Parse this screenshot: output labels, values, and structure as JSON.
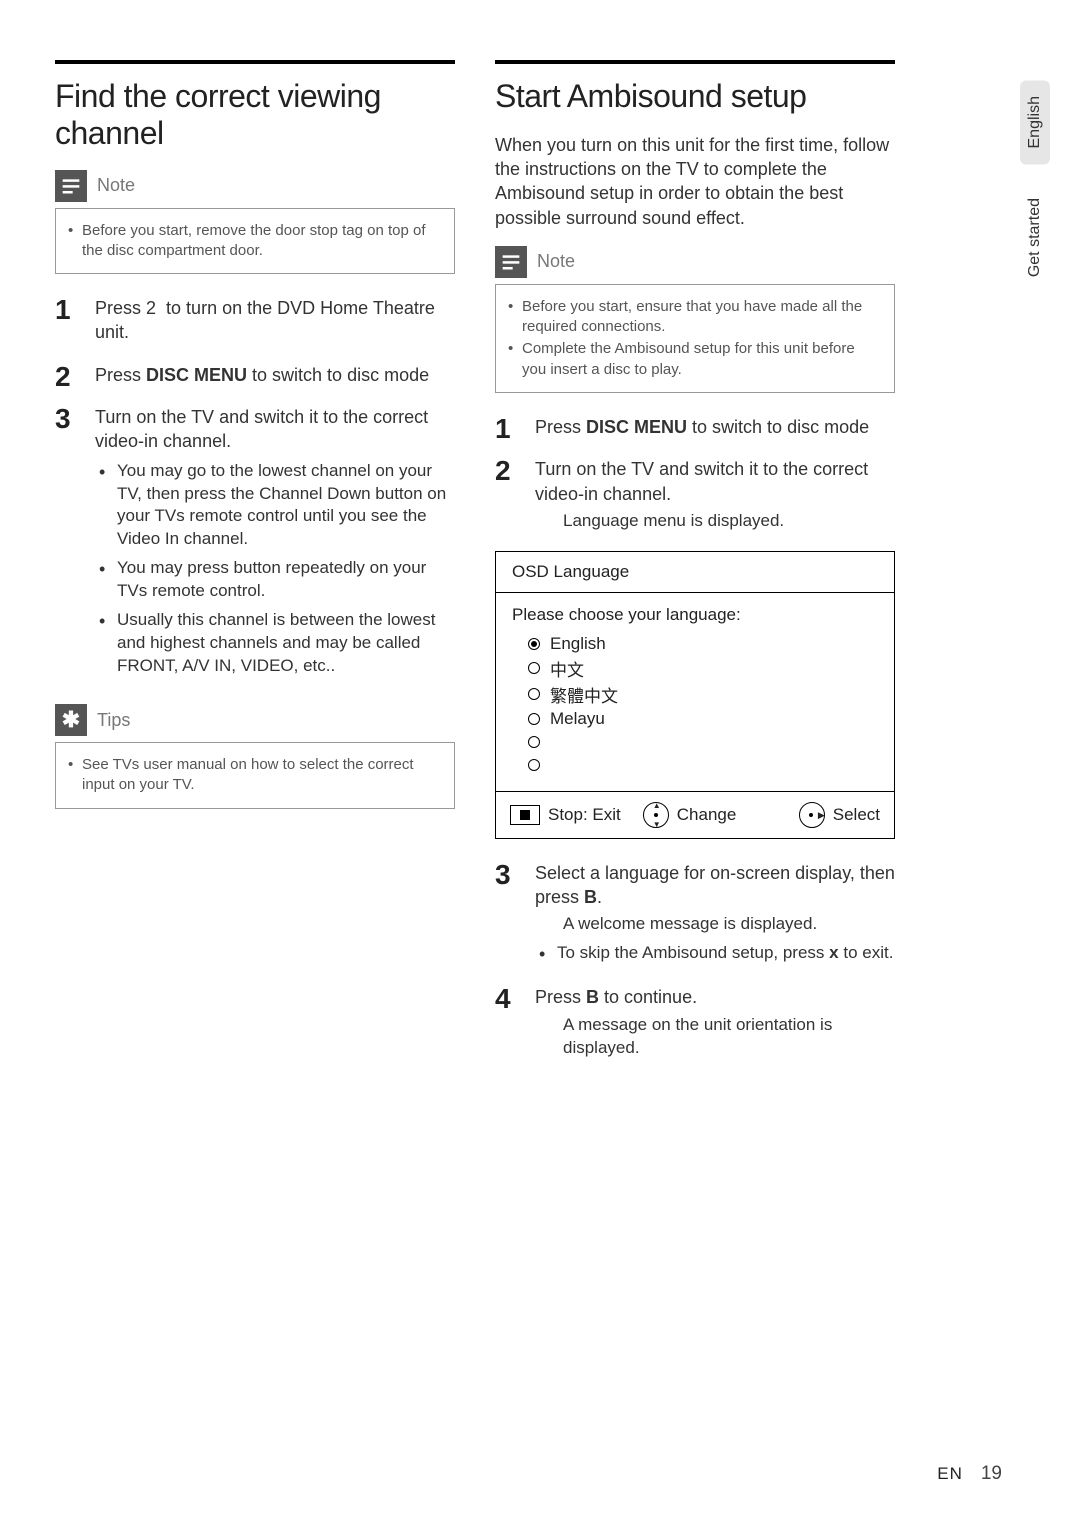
{
  "side_tabs": {
    "lang": "English",
    "section": "Get started"
  },
  "left": {
    "heading": "Find the correct viewing channel",
    "note_label": "Note",
    "note_items": [
      "Before you start, remove the door stop tag on top of the disc compartment door."
    ],
    "steps": [
      {
        "num": "1",
        "text_pre": "Press ",
        "text_btn": "2",
        "text_post": " to turn on the DVD Home Theatre unit."
      },
      {
        "num": "2",
        "text_pre": "Press ",
        "text_bold": "DISC MENU",
        "text_post": " to switch to disc mode"
      },
      {
        "num": "3",
        "text": "Turn on the TV and switch it to the correct video-in channel.",
        "bullets": [
          "You may go to the lowest channel on your TV, then press the Channel Down button on your TVs remote control until you see the Video In channel.",
          "You may press       button repeatedly on your TVs remote control.",
          "Usually this channel is between the lowest and highest channels and may be called FRONT, A/V IN, VIDEO, etc.."
        ]
      }
    ],
    "tips_label": "Tips",
    "tips_items": [
      "See TVs user manual on how to select the correct input on your TV."
    ]
  },
  "right": {
    "heading": "Start Ambisound setup",
    "intro": "When you turn on this unit for the first time, follow the instructions on the TV to complete the Ambisound setup in order to obtain the best possible surround sound effect.",
    "note_label": "Note",
    "note_items": [
      "Before you start, ensure that you have made all the required connections.",
      "Complete the Ambisound setup for this unit before you insert a disc to play."
    ],
    "steps_a": [
      {
        "num": "1",
        "text_pre": "Press ",
        "text_bold": "DISC MENU",
        "text_post": " to switch to disc mode"
      },
      {
        "num": "2",
        "text": "Turn on the TV and switch it to the correct video-in channel.",
        "sub": "Language menu is displayed."
      }
    ],
    "osd": {
      "title": "OSD Language",
      "prompt": "Please choose your language:",
      "options": [
        "English",
        "中文",
        "繁體中文",
        "Melayu",
        "",
        ""
      ],
      "selected_index": 0,
      "footer": {
        "stop": "Stop: Exit",
        "change": "Change",
        "select": "Select"
      }
    },
    "steps_b": [
      {
        "num": "3",
        "text_pre": "Select a language for on-screen display, then press ",
        "text_bold": "B",
        "text_post": ".",
        "sub": "A welcome message is displayed.",
        "bullets": [
          {
            "pre": "To skip the Ambisound setup, press ",
            "bold": "x",
            "post": " to exit."
          }
        ]
      },
      {
        "num": "4",
        "text_pre": "Press ",
        "text_bold": "B",
        "text_post": " to continue.",
        "sub": "A message on the unit orientation is displayed."
      }
    ]
  },
  "footer": {
    "label": "EN",
    "page": "19"
  }
}
